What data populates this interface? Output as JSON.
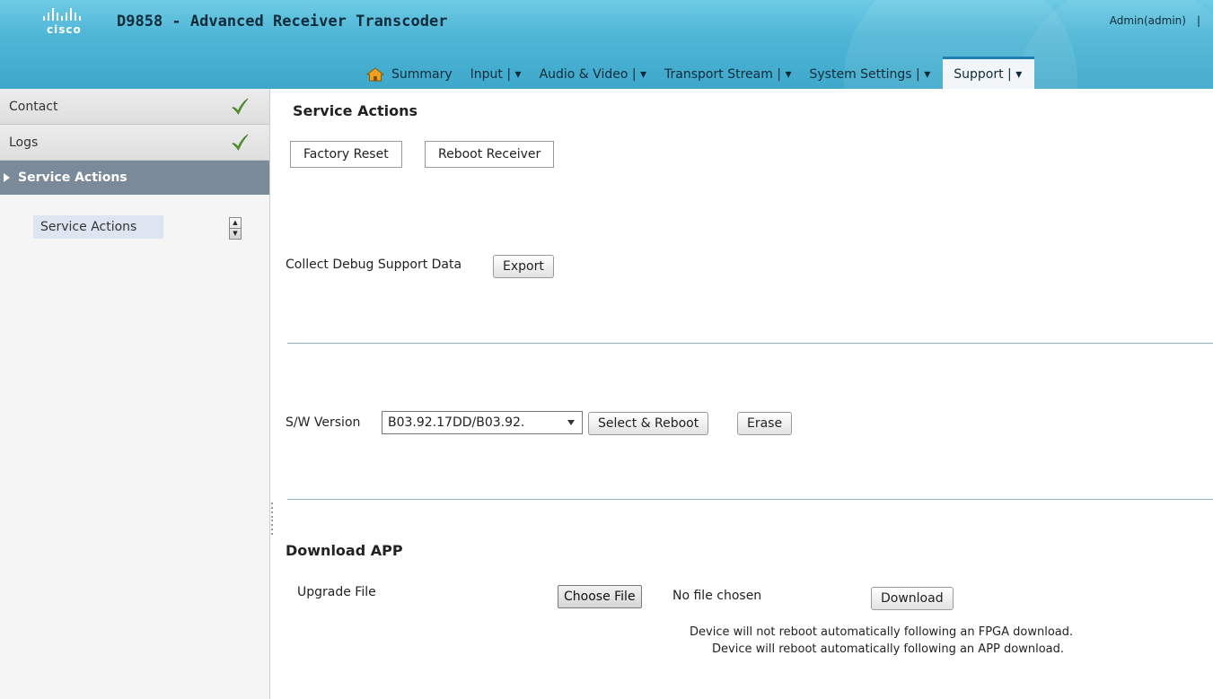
{
  "header": {
    "brand": "cisco",
    "title": "D9858 - Advanced Receiver Transcoder",
    "user": "Admin(admin)",
    "user_separator": "|"
  },
  "nav": {
    "items": [
      {
        "label": "Summary",
        "icon": "home-icon"
      },
      {
        "label": "Input | ▾"
      },
      {
        "label": "Audio & Video | ▾"
      },
      {
        "label": "Transport Stream | ▾"
      },
      {
        "label": "System Settings | ▾"
      },
      {
        "label": "Support | ▾",
        "active": true
      }
    ]
  },
  "sidebar": {
    "items": [
      {
        "label": "Contact",
        "status_icon": "check-icon"
      },
      {
        "label": "Logs",
        "status_icon": "check-icon"
      },
      {
        "label": "Service Actions",
        "selected": true
      }
    ],
    "sub_items": [
      {
        "label": "Service Actions"
      }
    ]
  },
  "main": {
    "service_actions": {
      "title": "Service Actions",
      "factory_reset_label": "Factory Reset",
      "reboot_receiver_label": "Reboot Receiver",
      "collect_debug_label": "Collect Debug Support Data",
      "export_label": "Export"
    },
    "software": {
      "version_label": "S/W Version",
      "version_value": "B03.92.17DD/B03.92.",
      "select_reboot_label": "Select & Reboot",
      "erase_label": "Erase"
    },
    "download_app": {
      "title": "Download APP",
      "upgrade_file_label": "Upgrade File",
      "choose_file_label": "Choose File",
      "no_file_text": "No file chosen",
      "download_label": "Download",
      "note_fpga": "Device will not reboot automatically following an FPGA download.",
      "note_app": "Device will reboot automatically following an APP download."
    }
  },
  "colors": {
    "header_accent": "#4fb6d6",
    "sidebar_selected": "#7b8a99",
    "check_green": "#5aa832"
  }
}
